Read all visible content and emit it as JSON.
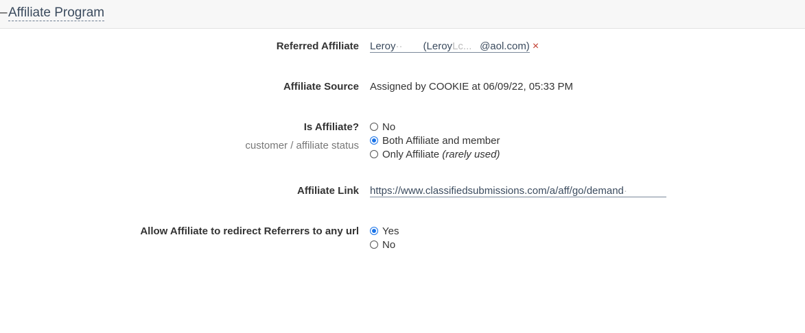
{
  "header": {
    "toggle_symbol": "–",
    "title": "Affiliate Program"
  },
  "referred_affiliate": {
    "label": "Referred Affiliate",
    "name": "Leroy",
    "name_masked": "·· ",
    "email_prefix": "(Leroy",
    "email_masked": "Lc...",
    "email_suffix": "@aol.com)",
    "remove_symbol": "×"
  },
  "affiliate_source": {
    "label": "Affiliate Source",
    "value": "Assigned by COOKIE at 06/09/22, 05:33 PM"
  },
  "is_affiliate": {
    "label": "Is Affiliate?",
    "sublabel": "customer / affiliate status",
    "options": [
      {
        "label": "No",
        "note": "",
        "checked": false
      },
      {
        "label": "Both Affiliate and member",
        "note": "",
        "checked": true
      },
      {
        "label": "Only Affiliate",
        "note": "(rarely used)",
        "checked": false
      }
    ]
  },
  "affiliate_link": {
    "label": "Affiliate Link",
    "url_visible": "https://www.classifiedsubmissions.com/a/aff/go/demand",
    "url_masked": "·"
  },
  "allow_redirect": {
    "label": "Allow Affiliate to redirect Referrers to any url",
    "options": [
      {
        "label": "Yes",
        "checked": true
      },
      {
        "label": "No",
        "checked": false
      }
    ]
  },
  "colors": {
    "accent": "#1a73e8",
    "link": "#3b4b5e",
    "remove": "#c0392b"
  }
}
